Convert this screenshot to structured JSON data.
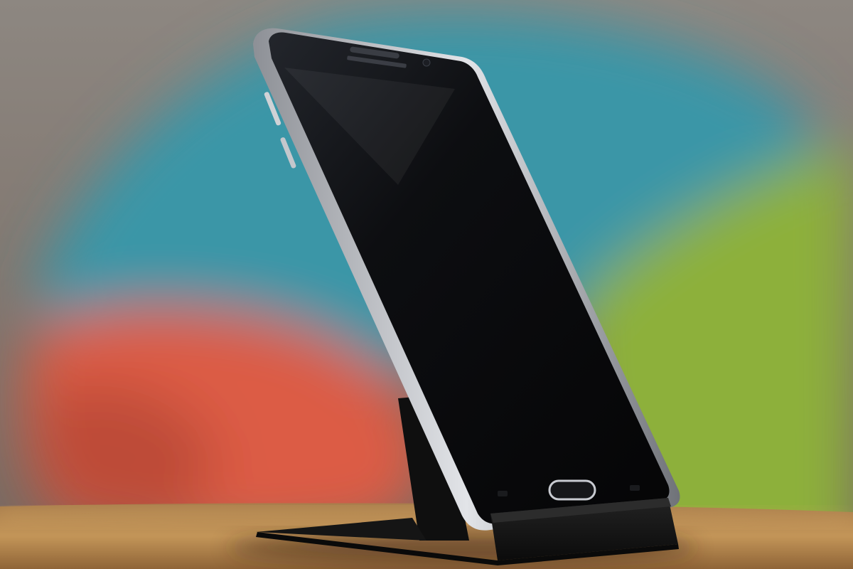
{
  "scene": {
    "subject": "smartphone-on-stand",
    "colors": {
      "wall": "#8c8580",
      "teal_cushion": "#3a97a8",
      "orange_cushion": "#de5c45",
      "green_cushion": "#8fb23a",
      "table": "#b88a52",
      "phone_body": "#0c0d10",
      "phone_frame": "#b9bcc2",
      "stand": "#141414"
    }
  }
}
